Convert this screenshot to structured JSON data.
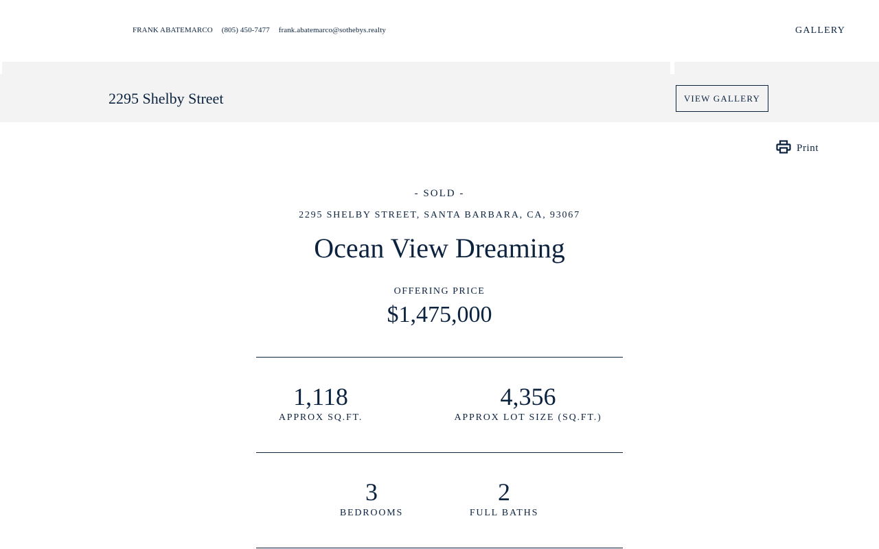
{
  "header": {
    "agent_name": "FRANK ABATEMARCO",
    "phone": "(805) 450-7477",
    "email": "frank.abatemarco@sothebys.realty",
    "gallery_link": "GALLERY"
  },
  "subheader": {
    "title": "2295 Shelby Street",
    "view_gallery_label": "VIEW GALLERY"
  },
  "print": {
    "label": "Print",
    "icon": "printer-icon"
  },
  "listing": {
    "status": "- SOLD -",
    "address": "2295 SHELBY STREET, SANTA BARBARA, CA, 93067",
    "headline": "Ocean View Dreaming",
    "price_label": "OFFERING PRICE",
    "price": "$1,475,000"
  },
  "stats": {
    "sqft": {
      "value": "1,118",
      "label": "APPROX SQ.FT."
    },
    "lot": {
      "value": "4,356",
      "label": "APPROX LOT SIZE (SQ.FT.)"
    },
    "bedrooms": {
      "value": "3",
      "label": "BEDROOMS"
    },
    "baths": {
      "value": "2",
      "label": "FULL BATHS"
    }
  },
  "colors": {
    "text": "#0c2340",
    "band": "#f3f3f3"
  }
}
